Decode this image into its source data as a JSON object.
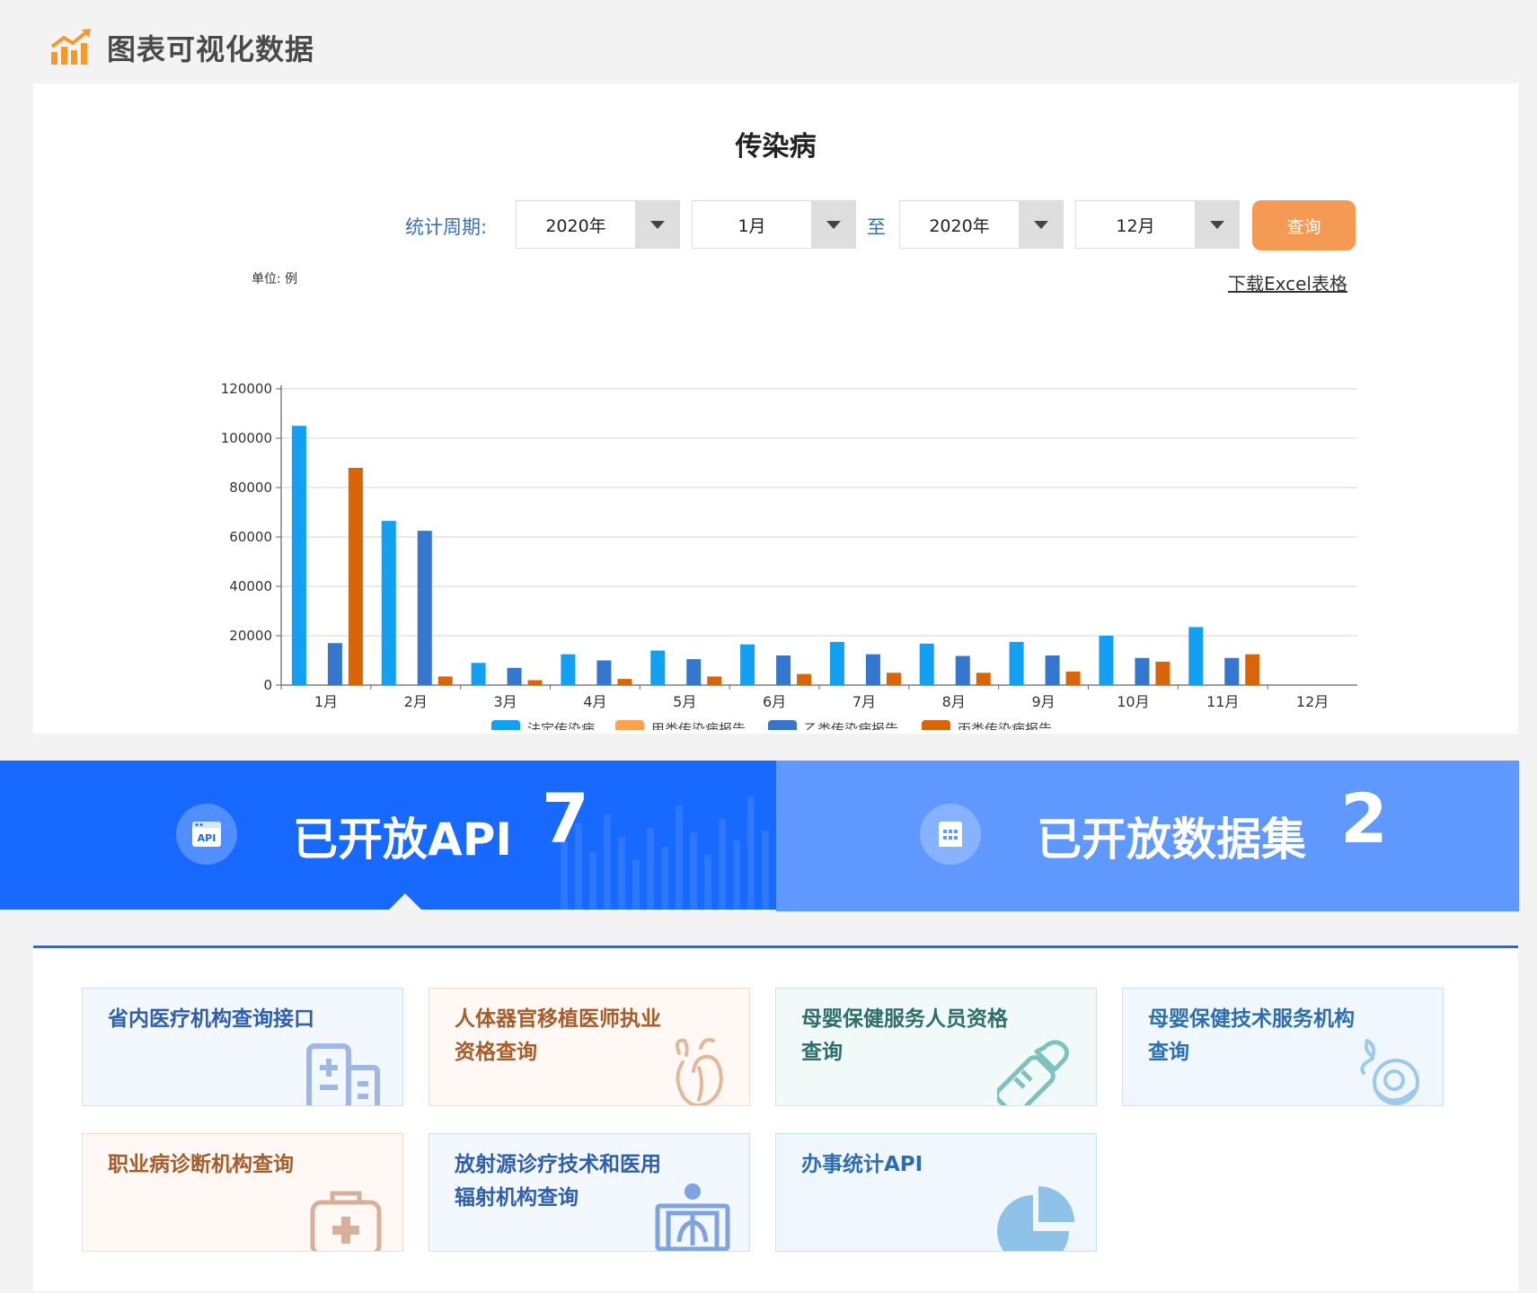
{
  "header": {
    "title": "图表可视化数据",
    "icon": "chart-growth-icon"
  },
  "chart_panel": {
    "title": "传染病",
    "filter": {
      "label": "统计周期:",
      "start_year": "2020年",
      "start_month": "1月",
      "to_label": "至",
      "end_year": "2020年",
      "end_month": "12月",
      "query_button": "查询"
    },
    "unit_label": "单位: 例",
    "download_link": "下载Excel表格"
  },
  "chart_data": {
    "type": "bar",
    "title": "传染病",
    "xlabel": "",
    "ylabel": "单位: 例",
    "ylim": [
      0,
      120000
    ],
    "yticks": [
      0,
      20000,
      40000,
      60000,
      80000,
      100000,
      120000
    ],
    "categories": [
      "1月",
      "2月",
      "3月",
      "4月",
      "5月",
      "6月",
      "7月",
      "8月",
      "9月",
      "10月",
      "11月",
      "12月"
    ],
    "series": [
      {
        "name": "法定传染病",
        "color": "#13a0f2",
        "values": [
          105000,
          66500,
          9000,
          12500,
          14000,
          16500,
          17500,
          16800,
          17500,
          20000,
          23500,
          0
        ]
      },
      {
        "name": "甲类传染病报告",
        "color": "#ffa04d",
        "values": [
          0,
          0,
          0,
          0,
          0,
          0,
          0,
          0,
          0,
          0,
          0,
          0
        ]
      },
      {
        "name": "乙类传染病报告",
        "color": "#3577cf",
        "values": [
          17000,
          62500,
          7000,
          10000,
          10500,
          12000,
          12500,
          11800,
          12000,
          11000,
          11000,
          0
        ]
      },
      {
        "name": "丙类传染病报告",
        "color": "#d9650a",
        "values": [
          88000,
          3500,
          2000,
          2500,
          3500,
          4500,
          5000,
          5000,
          5500,
          9500,
          12500,
          0
        ]
      }
    ],
    "legend_position": "bottom",
    "grid": true
  },
  "stats": {
    "api_label": "已开放API",
    "api_count": "7",
    "api_icon_text": "API",
    "dataset_label": "已开放数据集",
    "dataset_count": "2"
  },
  "api_cards": [
    {
      "title": "省内医疗机构查询接口",
      "icon": "hospital-building-icon"
    },
    {
      "title": "人体器官移植医师执业资格查询",
      "icon": "heart-organ-icon"
    },
    {
      "title": "母婴保健服务人员资格查询",
      "icon": "baby-bottle-icon"
    },
    {
      "title": "母婴保健技术服务机构查询",
      "icon": "mother-baby-icon"
    },
    {
      "title": "职业病诊断机构查询",
      "icon": "medical-kit-icon"
    },
    {
      "title": "放射源诊疗技术和医用辐射机构查询",
      "icon": "xray-icon"
    },
    {
      "title": "办事统计API",
      "icon": "pie-chart-icon"
    }
  ]
}
